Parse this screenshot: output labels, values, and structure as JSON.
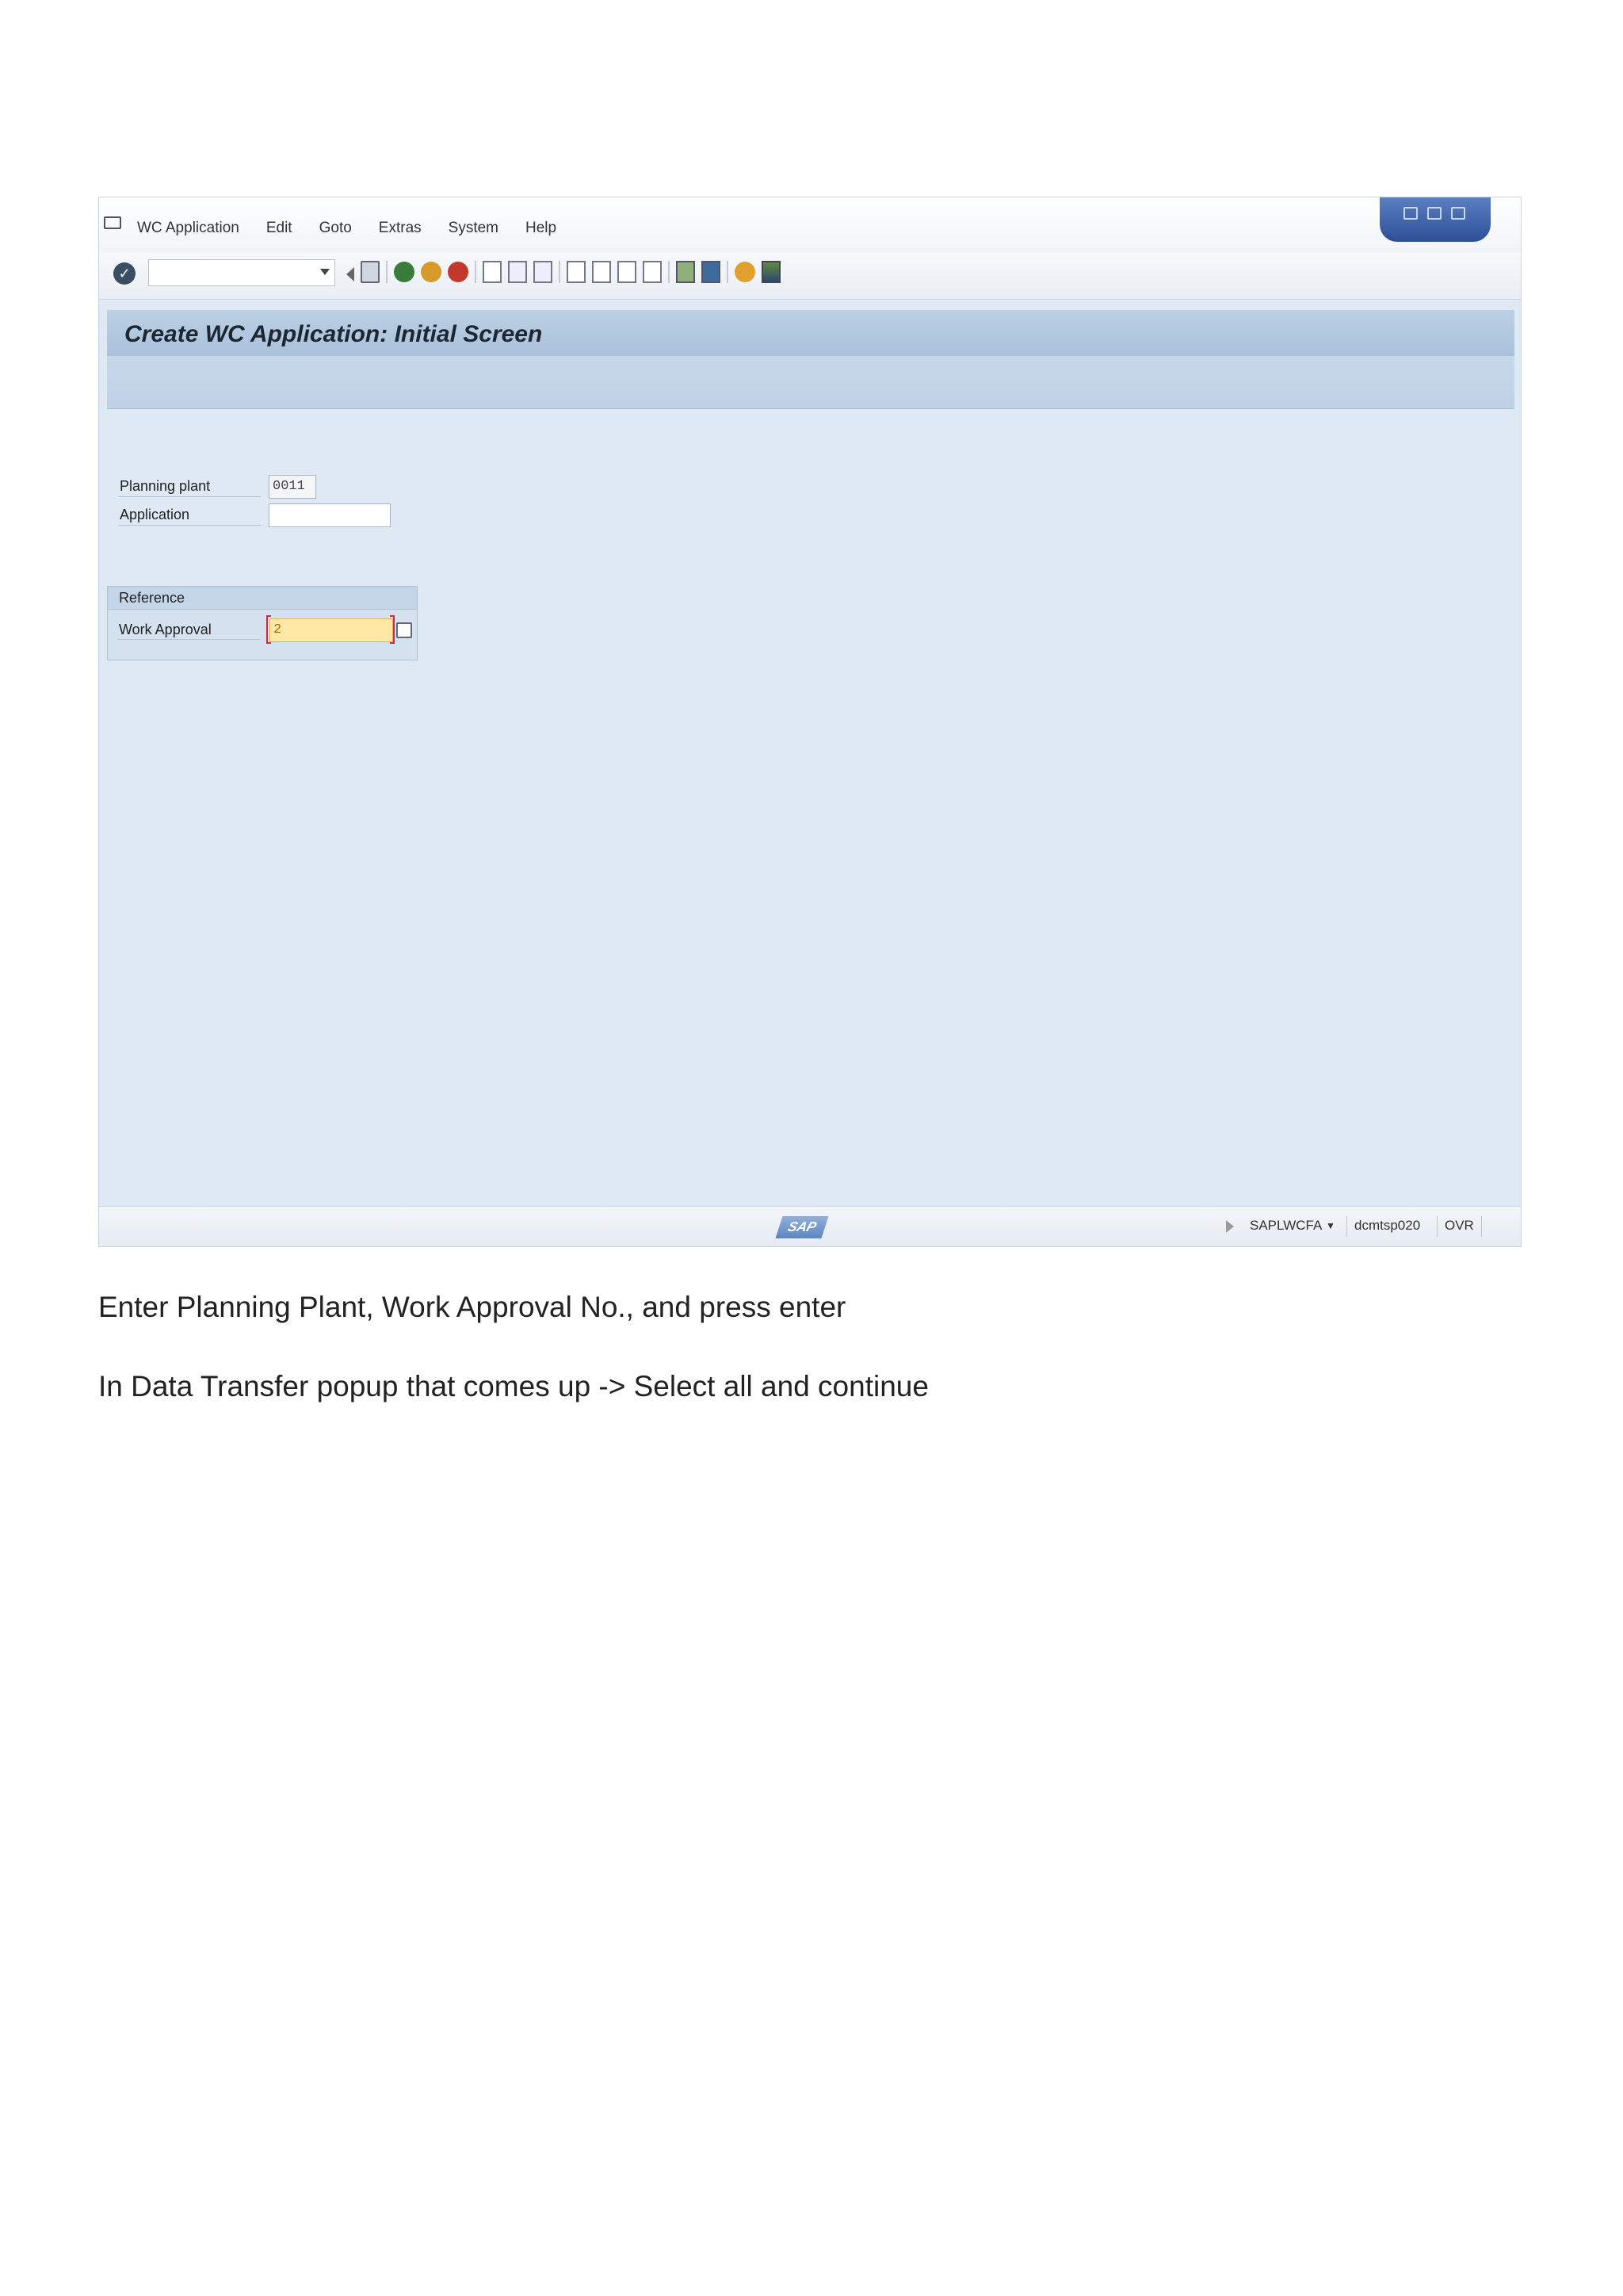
{
  "menu": {
    "items": [
      "WC Application",
      "Edit",
      "Goto",
      "Extras",
      "System",
      "Help"
    ]
  },
  "page": {
    "title": "Create WC Application: Initial Screen"
  },
  "form": {
    "planning_plant_label": "Planning plant",
    "planning_plant_value": "0011",
    "application_label": "Application",
    "application_value": "",
    "reference_group_label": "Reference",
    "work_approval_label": "Work Approval",
    "work_approval_value": "2"
  },
  "status": {
    "logo_text": "SAP",
    "program": "SAPLWCFA",
    "server": "dcmtsp020",
    "mode": "OVR"
  },
  "instructions": [
    "Enter Planning Plant, Work Approval No., and press enter",
    "In Data Transfer popup that comes up -> Select all and continue"
  ]
}
